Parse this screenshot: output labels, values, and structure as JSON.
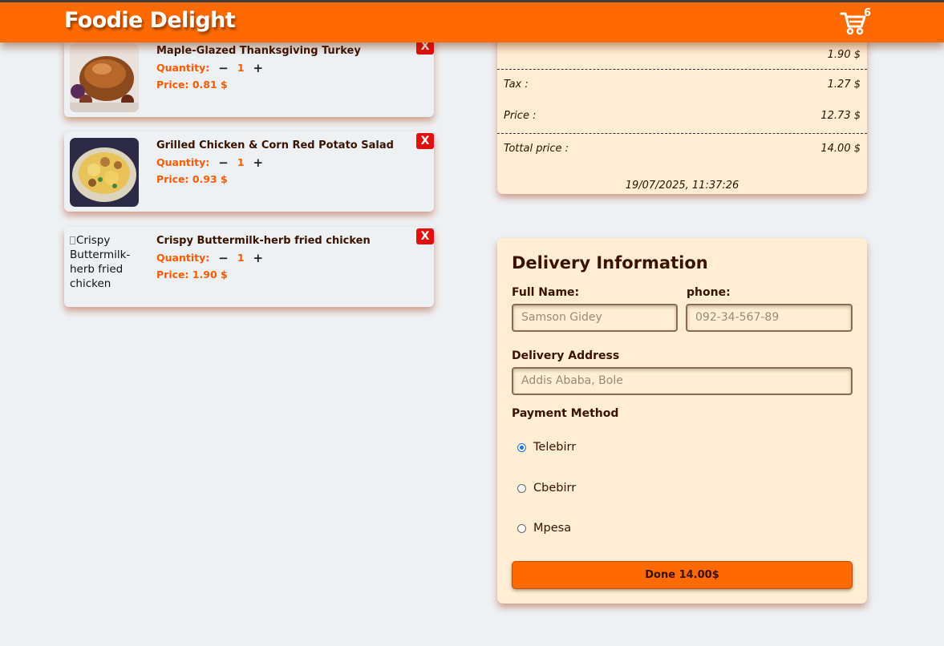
{
  "header": {
    "brand": "Foodie Delight",
    "cart_count": "6",
    "cart_icon": "cart-icon"
  },
  "cart_items": [
    {
      "title": "Maple-Glazed Thanksgiving Turkey",
      "qty_label": "Quantity:",
      "qty": "1",
      "minus": "−",
      "plus": "+",
      "price": "Price: 0.81 $",
      "remove": "X"
    },
    {
      "title": "Grilled Chicken & Corn Red Potato Salad",
      "qty_label": "Quantity:",
      "qty": "1",
      "minus": "−",
      "plus": "+",
      "price": "Price: 0.93 $",
      "remove": "X"
    },
    {
      "title": "Crispy Buttermilk-herb fried chicken",
      "qty_label": "Quantity:",
      "qty": "1",
      "minus": "−",
      "plus": "+",
      "price": "Price: 1.90 $",
      "remove": "X",
      "image_alt": "Crispy Buttermilk-herb fried chicken"
    }
  ],
  "summary": {
    "item_price": "1.90 $",
    "tax_label": "Tax :",
    "tax": "1.27 $",
    "price_label": "Price :",
    "price": "12.73 $",
    "total_label": "Tottal price :",
    "total": "14.00 $",
    "datetime": "19/07/2025, 11:37:26"
  },
  "delivery": {
    "title": "Delivery Information",
    "name_label": "Full Name:",
    "name_placeholder": "Samson Gidey",
    "phone_label": "phone:",
    "phone_placeholder": "092-34-567-89",
    "address_label": "Delivery Address",
    "address_placeholder": "Addis Ababa, Bole",
    "payment_label": "Payment Method",
    "payment_options": [
      "Telebirr",
      "Cbebirr",
      "Mpesa"
    ],
    "selected_payment": "Telebirr",
    "done_label": "Done 14.00$"
  },
  "colors": {
    "accent": "#ff6a00",
    "remove": "#e20f0f",
    "panel": "#ffeed3",
    "background": "#edf1f3"
  }
}
